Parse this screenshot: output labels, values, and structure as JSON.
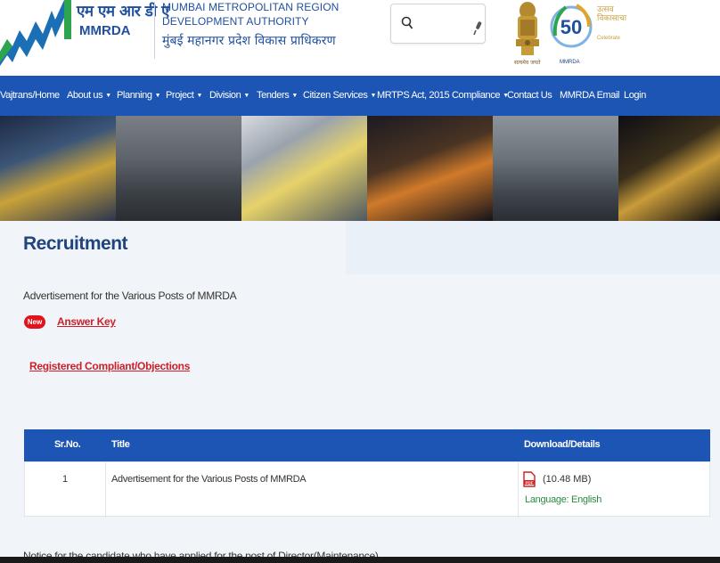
{
  "header": {
    "logo_hindi": "एम एम आर डी ए",
    "logo_en": "MMRDA",
    "org_line1": "MUMBAI METROPOLITAN REGION",
    "org_line2": "DEVELOPMENT AUTHORITY",
    "org_line3": "मुंबई महानगर प्रदेश विकास प्राधिकरण",
    "emblem_caption": "सत्यमेव जयते",
    "badge_caption": "MMRDA",
    "celebration_hi": "उत्सव विकासाचा",
    "celebration_en": "Celebrate"
  },
  "search": {
    "placeholder": "",
    "icon": "search-icon",
    "mic_icon": "mic-icon"
  },
  "nav": {
    "items": [
      {
        "label": "Vajtrans/Home",
        "caret": false
      },
      {
        "label": "About us",
        "caret": true
      },
      {
        "label": "Planning",
        "caret": true
      },
      {
        "label": "Project",
        "caret": true
      },
      {
        "label": "Division",
        "caret": true
      },
      {
        "label": "Tenders",
        "caret": true
      },
      {
        "label": "Citizen Services",
        "caret": true
      },
      {
        "label": "MRTPS Act, 2015",
        "caret": false
      },
      {
        "label": "Compliance",
        "caret": true
      },
      {
        "label": "Contact Us",
        "caret": false
      },
      {
        "label": "MMRDA Email",
        "caret": false
      },
      {
        "label": "Login",
        "caret": false
      }
    ],
    "caret_glyph": "▼"
  },
  "page": {
    "title": "Recruitment",
    "ad_text": "Advertisement for the Various Posts of MMRDA",
    "new_badge": "New",
    "answer_key": "Answer Key",
    "registered_link": "Registered Compliant/Objections",
    "notice": "Notice for the candidate who have applied for the post of Director(Maintenance)"
  },
  "table": {
    "headers": [
      "Sr.No.",
      "Title",
      "Download/Details"
    ],
    "rows": [
      {
        "sr": "1",
        "title": "Advertisement for the Various Posts of MMRDA",
        "size": "(10.48 MB)",
        "language": "Language: English"
      }
    ]
  },
  "colors": {
    "nav_blue": "#1c55b3",
    "title_blue": "#21437e",
    "link_red": "#cc1f2a",
    "lang_green": "#2b8a3e"
  }
}
